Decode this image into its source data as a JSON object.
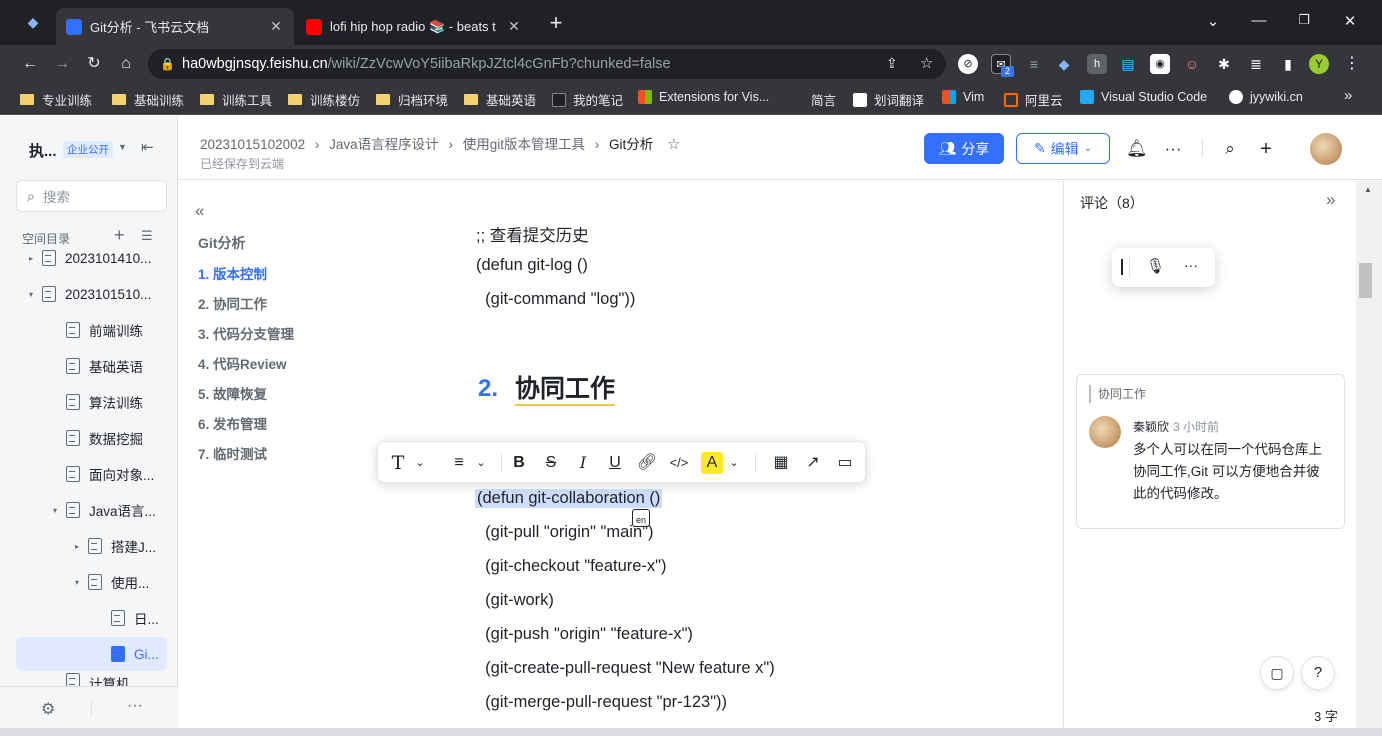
{
  "browser": {
    "tabs": [
      {
        "title": "Git分析 - 飞书云文档",
        "active": true
      },
      {
        "title": "lofi hip hop radio 📚 - beats t",
        "active": false
      }
    ],
    "new_tab": "+",
    "url": {
      "host": "ha0wbgjnsqy.feishu.cn",
      "path": "/wiki/ZzVcwVoY5iibaRkpJZtcl4cGnFb?chunked=false"
    },
    "profile_initial": "Y",
    "ext_badge": "2",
    "bookmarks": [
      "专业训练",
      "基础训练",
      "训练工具",
      "训练楼仿",
      "归档环境",
      "基础英语",
      "我的笔记",
      "Extensions for Vis...",
      "简言",
      "划词翻译",
      "Vim",
      "阿里云",
      "Visual Studio Code",
      "jyywiki.cn"
    ],
    "more_bookmarks": "»"
  },
  "sidebar": {
    "space_name": "执...",
    "badge": "企业公开",
    "search_placeholder": "搜索",
    "section_label": "空间目录",
    "items": [
      {
        "label": "2023101410...",
        "level": 0,
        "caret": "▸"
      },
      {
        "label": "2023101510...",
        "level": 0,
        "caret": "▾"
      },
      {
        "label": "前端训练",
        "level": 1,
        "caret": ""
      },
      {
        "label": "基础英语",
        "level": 1,
        "caret": ""
      },
      {
        "label": "算法训练",
        "level": 1,
        "caret": ""
      },
      {
        "label": "数据挖掘",
        "level": 1,
        "caret": ""
      },
      {
        "label": "面向对象...",
        "level": 1,
        "caret": ""
      },
      {
        "label": "Java语言...",
        "level": 1,
        "caret": "▾"
      },
      {
        "label": "搭建J...",
        "level": 2,
        "caret": "▸"
      },
      {
        "label": "使用...",
        "level": 2,
        "caret": "▾"
      },
      {
        "label": "日...",
        "level": 3,
        "caret": ""
      },
      {
        "label": "Gi...",
        "level": 3,
        "caret": "",
        "selected": true
      },
      {
        "label": "计算机...",
        "level": 1,
        "caret": ""
      }
    ]
  },
  "header": {
    "breadcrumbs": [
      "20231015102002",
      "Java语言程序设计",
      "使用git版本管理工具",
      "Git分析"
    ],
    "saved_status": "已经保存到云端",
    "share_label": "分享",
    "edit_label": "编辑"
  },
  "outline": {
    "title": "Git分析",
    "items": [
      "1. 版本控制",
      "2. 协同工作",
      "3. 代码分支管理",
      "4. 代码Review",
      "5. 故障恢复",
      "6. 发布管理",
      "7. 临时测试"
    ],
    "active_index": 0
  },
  "document": {
    "lines_before": [
      ";; 查看提交历史",
      "(defun git-log ()",
      "  (git-command \"log\"))"
    ],
    "heading_number": "2.",
    "heading_text": "协同工作",
    "selected_line": "(defun git-collaboration ()",
    "lines_after": [
      "  (git-pull \"origin\" \"main\")",
      "  (git-checkout \"feature-x\")",
      "  (git-work)",
      "  (git-push \"origin\" \"feature-x\")",
      "  (git-create-pull-request \"New feature x\")",
      "  (git-merge-pull-request \"pr-123\"))"
    ],
    "cursor_tag": "en"
  },
  "comments": {
    "header": "评论（8）",
    "quote": "协同工作",
    "author": "秦颖欣",
    "time": "3 小时前",
    "text": "多个人可以在同一个代码仓库上协同工作,Git 可以方便地合并彼此的代码修改。",
    "word_count": "3 字"
  }
}
